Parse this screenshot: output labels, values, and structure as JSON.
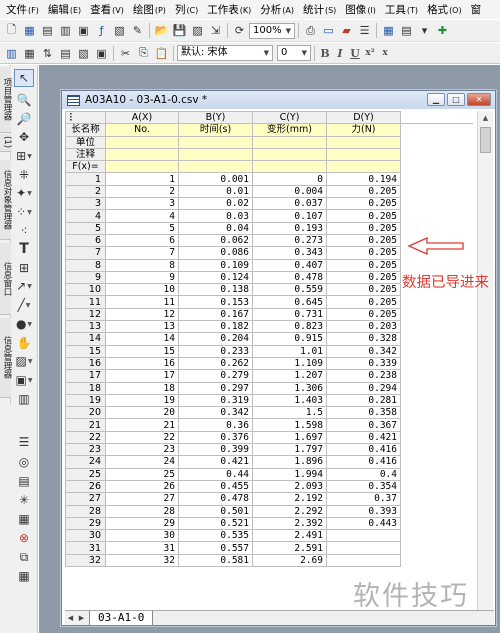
{
  "menu": [
    {
      "label": "文件",
      "key": "(F)"
    },
    {
      "label": "编辑",
      "key": "(E)"
    },
    {
      "label": "查看",
      "key": "(V)"
    },
    {
      "label": "绘图",
      "key": "(P)"
    },
    {
      "label": "列",
      "key": "(C)"
    },
    {
      "label": "工作表",
      "key": "(K)"
    },
    {
      "label": "分析",
      "key": "(A)"
    },
    {
      "label": "统计",
      "key": "(S)"
    },
    {
      "label": "图像",
      "key": "(I)"
    },
    {
      "label": "工具",
      "key": "(T)"
    },
    {
      "label": "格式",
      "key": "(O)"
    },
    {
      "label": "窗",
      "key": ""
    }
  ],
  "toolbar": {
    "zoom": "100%",
    "font_label": "默认: 宋体",
    "size_value": "0",
    "bold": "B",
    "italic": "I",
    "underline": "U",
    "superscript": "x²",
    "subscript": "x"
  },
  "side_tabs": [
    "项目管理器",
    "(1)",
    "信息对象管理器",
    "信息窗口",
    "信息管理器"
  ],
  "workbook": {
    "title": "A03A10 - 03-A1-0.csv *",
    "sheet_tab": "03-A1-0",
    "columns": [
      "A(X)",
      "B(Y)",
      "C(Y)",
      "D(Y)"
    ],
    "meta_rows": [
      {
        "label": "长名称",
        "values": [
          "No.",
          "时间(s)",
          "变形(mm)",
          "力(N)"
        ]
      },
      {
        "label": "单位",
        "values": [
          "",
          "",
          "",
          ""
        ]
      },
      {
        "label": "注释",
        "values": [
          "",
          "",
          "",
          ""
        ]
      },
      {
        "label": "F(x)=",
        "values": [
          "",
          "",
          "",
          ""
        ]
      }
    ],
    "rows": [
      [
        "1",
        "1",
        "0.001",
        "0",
        "0.194"
      ],
      [
        "2",
        "2",
        "0.01",
        "0.004",
        "0.205"
      ],
      [
        "3",
        "3",
        "0.02",
        "0.037",
        "0.205"
      ],
      [
        "4",
        "4",
        "0.03",
        "0.107",
        "0.205"
      ],
      [
        "5",
        "5",
        "0.04",
        "0.193",
        "0.205"
      ],
      [
        "6",
        "6",
        "0.062",
        "0.273",
        "0.205"
      ],
      [
        "7",
        "7",
        "0.086",
        "0.343",
        "0.205"
      ],
      [
        "8",
        "8",
        "0.109",
        "0.407",
        "0.205"
      ],
      [
        "9",
        "9",
        "0.124",
        "0.478",
        "0.205"
      ],
      [
        "10",
        "10",
        "0.138",
        "0.559",
        "0.205"
      ],
      [
        "11",
        "11",
        "0.153",
        "0.645",
        "0.205"
      ],
      [
        "12",
        "12",
        "0.167",
        "0.731",
        "0.205"
      ],
      [
        "13",
        "13",
        "0.182",
        "0.823",
        "0.203"
      ],
      [
        "14",
        "14",
        "0.204",
        "0.915",
        "0.328"
      ],
      [
        "15",
        "15",
        "0.233",
        "1.01",
        "0.342"
      ],
      [
        "16",
        "16",
        "0.262",
        "1.109",
        "0.339"
      ],
      [
        "17",
        "17",
        "0.279",
        "1.207",
        "0.238"
      ],
      [
        "18",
        "18",
        "0.297",
        "1.306",
        "0.294"
      ],
      [
        "19",
        "19",
        "0.319",
        "1.403",
        "0.281"
      ],
      [
        "20",
        "20",
        "0.342",
        "1.5",
        "0.358"
      ],
      [
        "21",
        "21",
        "0.36",
        "1.598",
        "0.367"
      ],
      [
        "22",
        "22",
        "0.376",
        "1.697",
        "0.421"
      ],
      [
        "23",
        "23",
        "0.399",
        "1.797",
        "0.416"
      ],
      [
        "24",
        "24",
        "0.421",
        "1.896",
        "0.416"
      ],
      [
        "25",
        "25",
        "0.44",
        "1.994",
        "0.4"
      ],
      [
        "26",
        "26",
        "0.455",
        "2.093",
        "0.354"
      ],
      [
        "27",
        "27",
        "0.478",
        "2.192",
        "0.37"
      ],
      [
        "28",
        "28",
        "0.501",
        "2.292",
        "0.393"
      ],
      [
        "29",
        "29",
        "0.521",
        "2.392",
        "0.443"
      ],
      [
        "30",
        "30",
        "0.535",
        "2.491",
        ""
      ],
      [
        "31",
        "31",
        "0.557",
        "2.591",
        ""
      ],
      [
        "32",
        "32",
        "0.581",
        "2.69",
        ""
      ]
    ]
  },
  "annotation": {
    "text": "数据已导进来",
    "color": "#e0392f"
  },
  "watermark": "软件技巧"
}
